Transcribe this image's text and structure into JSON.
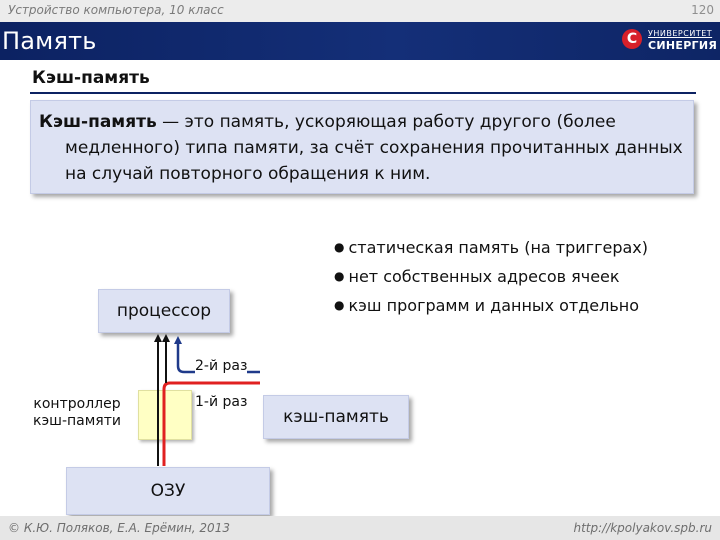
{
  "header": {
    "course": "Устройство компьютера, 10 класс",
    "page_number": "120",
    "title": "Память"
  },
  "logo": {
    "mark": "С",
    "top_text": "УНИВЕРСИТЕТ",
    "main_text": "СИНЕРГИЯ",
    "brand_color": "#d8202a"
  },
  "section": {
    "heading": "Кэш-память"
  },
  "definition": {
    "term": "Кэш-память",
    "text": " — это память, ускоряющая работу другого (более медленного) типа памяти, за счёт сохранения прочитанных данных на случай повторного обращения к ним."
  },
  "bullets": [
    "статическая память (на триггерах)",
    "нет собственных адресов ячеек",
    "кэш программ и данных отдельно"
  ],
  "diagram": {
    "processor_label": "процессор",
    "controller_label": "контроллер кэш-памяти",
    "cache_label": "кэш-память",
    "ram_label": "ОЗУ",
    "route_second": "2-й раз",
    "route_first": "1-й раз",
    "colors": {
      "first_path": "#e02020",
      "second_path": "#1f3a8a",
      "box_fill": "#dde2f3",
      "controller_fill": "#ffffc4"
    }
  },
  "footer": {
    "copyright": "© К.Ю. Поляков, Е.А. Ерёмин, 2013",
    "url": "http://kpolyakov.spb.ru"
  }
}
